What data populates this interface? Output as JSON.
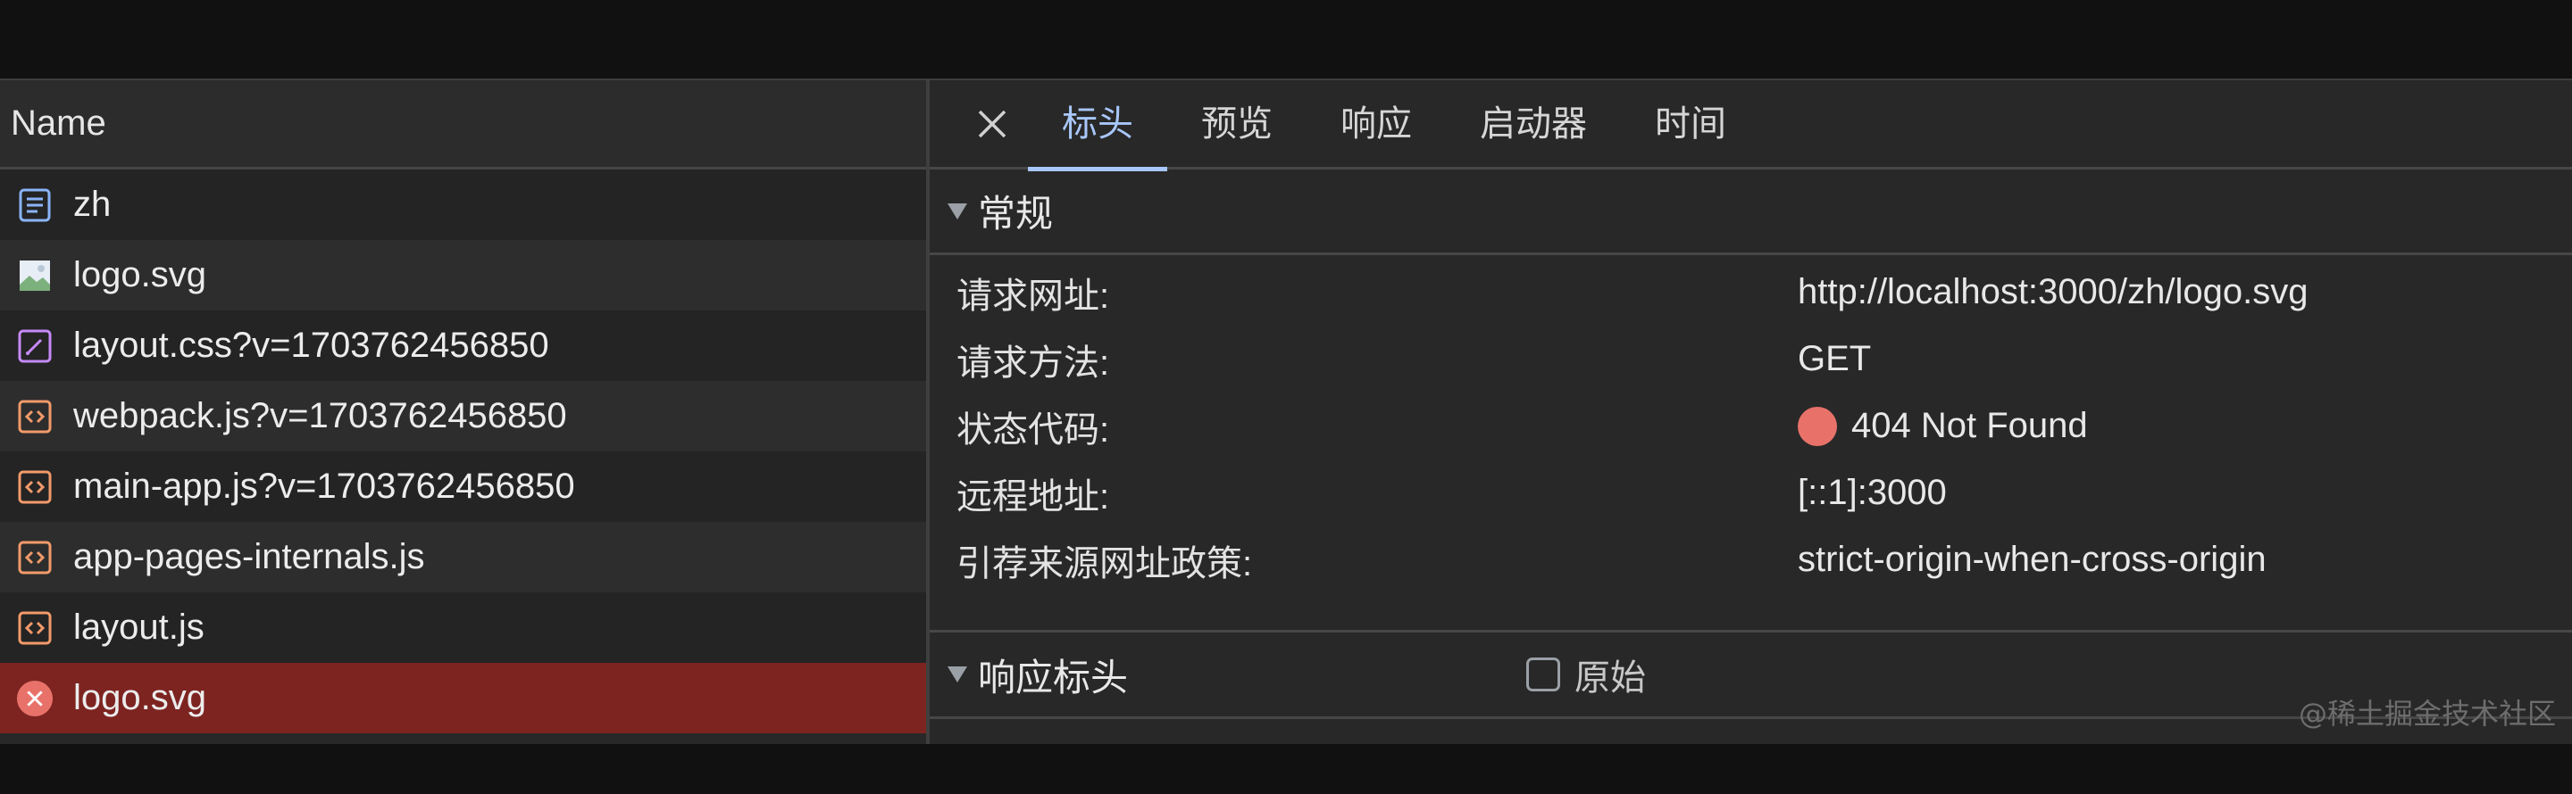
{
  "left_panel": {
    "header": "Name",
    "rows": [
      {
        "label": "zh",
        "icon": "document-icon"
      },
      {
        "label": "logo.svg",
        "icon": "image-icon"
      },
      {
        "label": "layout.css?v=1703762456850",
        "icon": "stylesheet-icon"
      },
      {
        "label": "webpack.js?v=1703762456850",
        "icon": "script-icon"
      },
      {
        "label": "main-app.js?v=1703762456850",
        "icon": "script-icon"
      },
      {
        "label": "app-pages-internals.js",
        "icon": "script-icon"
      },
      {
        "label": "layout.js",
        "icon": "script-icon"
      },
      {
        "label": "logo.svg",
        "icon": "error-icon",
        "selected": true
      }
    ]
  },
  "tabs": [
    "标头",
    "预览",
    "响应",
    "启动器",
    "时间"
  ],
  "active_tab": "标头",
  "general": {
    "title": "常规",
    "rows": [
      {
        "key": "请求网址:",
        "value": "http://localhost:3000/zh/logo.svg"
      },
      {
        "key": "请求方法:",
        "value": "GET"
      },
      {
        "key": "状态代码:",
        "value": "404 Not Found"
      },
      {
        "key": "远程地址:",
        "value": "[::1]:3000"
      },
      {
        "key": "引荐来源网址政策:",
        "value": "strict-origin-when-cross-origin"
      }
    ]
  },
  "response_headers": {
    "title": "响应标头",
    "raw_label": "原始",
    "raw_checked": false
  },
  "watermark": "@稀土掘金技术社区",
  "colors": {
    "status_error": "#e8726a",
    "selected_row": "#7d2421",
    "active_tab": "#a8c7fa"
  }
}
